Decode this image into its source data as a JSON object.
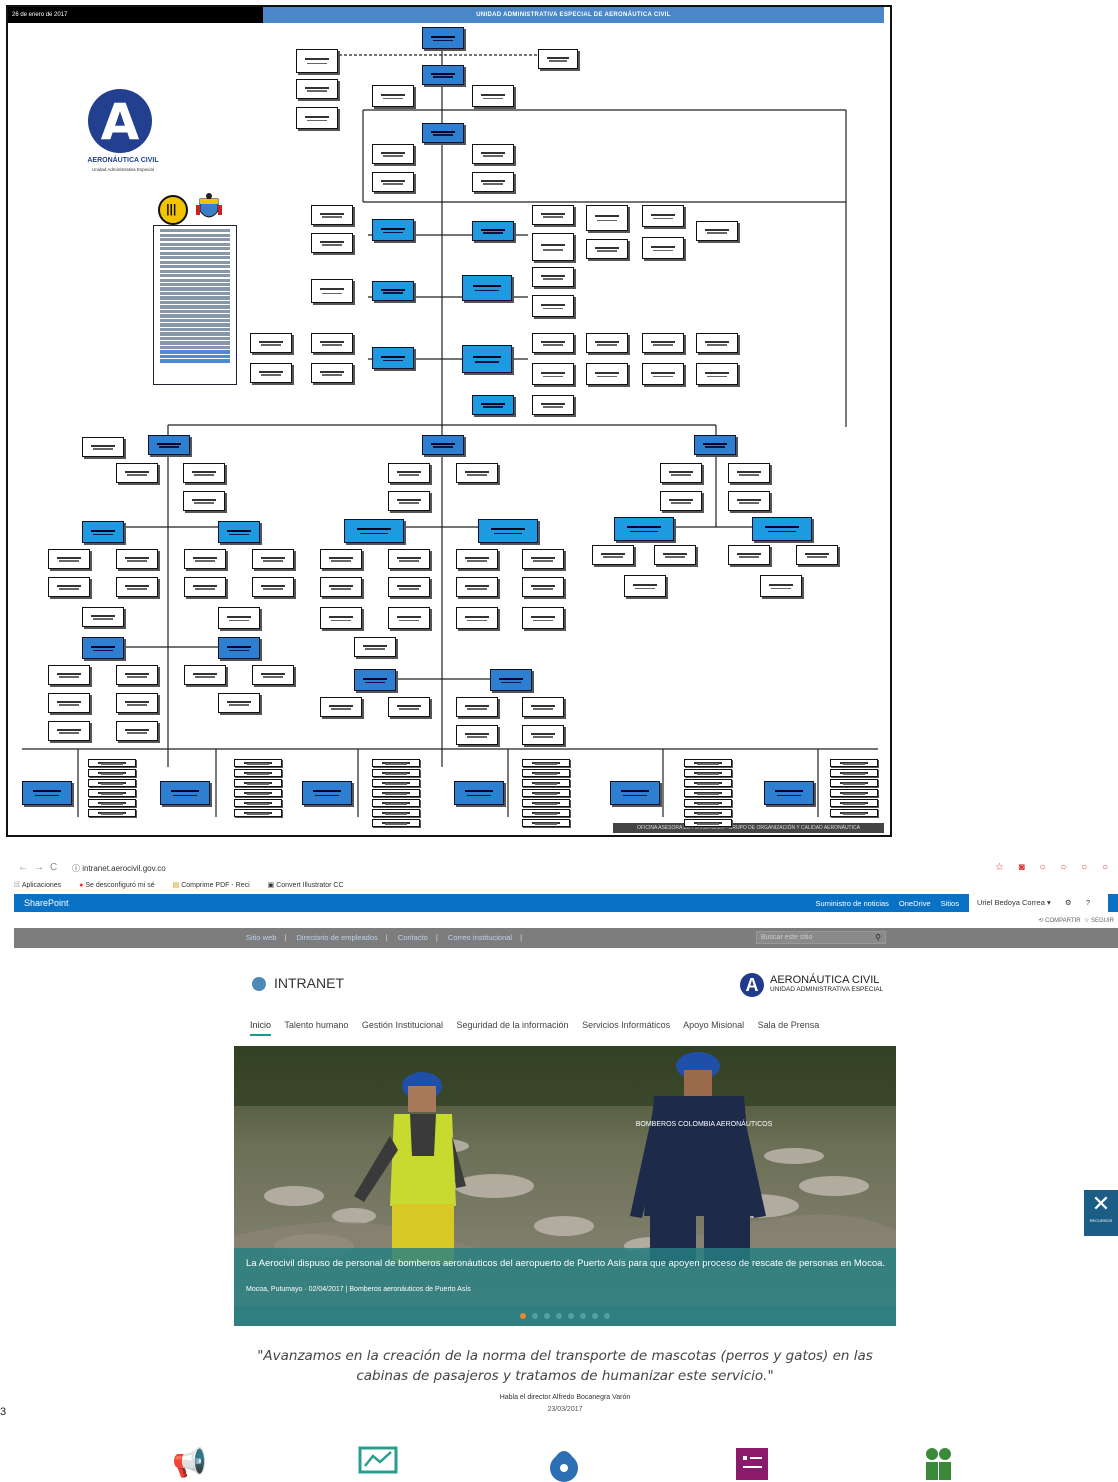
{
  "org_chart": {
    "date": "26 de enero de 2017",
    "title": "UNIDAD ADMINISTRATIVA ESPECIAL DE AERONÁUTICA CIVIL",
    "footer": "OFICINA ASESORA DE PLANEACIÓN - GRUPO DE ORGANIZACIÓN Y CALIDAD AERONÁUTICA",
    "logo_name": "AERONÁUTICA CIVIL",
    "logo_sub": "Unidad Administrativa Especial"
  },
  "page_number": "3",
  "browser": {
    "url": "intranet.aerocivil.gov.co",
    "bookmarks": [
      "Aplicaciones",
      "Se desconfiguró mi sé",
      "Comprime PDF - Reci",
      "Convert Illustrator CC"
    ]
  },
  "sharepoint": {
    "brand": "SharePoint",
    "links": [
      "Suministro de noticias",
      "OneDrive",
      "Sitios"
    ],
    "user": "Uriel Bedoya Correa ▾",
    "share": "COMPARTIR",
    "follow": "SEGUIR"
  },
  "site_nav": {
    "links": [
      "Sitio web",
      "Directorio de empleados",
      "Contacto",
      "Correo institucional"
    ],
    "search_placeholder": "Buscar este sitio"
  },
  "header": {
    "intranet": "INTRANET",
    "logo_title": "AERONÁUTICA CIVIL",
    "logo_sub": "UNIDAD ADMINISTRATIVA ESPECIAL"
  },
  "main_nav": [
    "Inicio",
    "Talento humano",
    "Gestión Institucional",
    "Seguridad de la información",
    "Servicios Informáticos",
    "Apoyo Misional",
    "Sala de Prensa"
  ],
  "hero": {
    "headline": "La Aerocivil dispuso de personal de bomberos aeronáuticos del aeropuerto de Puerto Asís para que apoyen proceso de rescate de personas en Mocoa.",
    "meta": "Mocoa, Putumayo · 02/04/2017 | Bomberos aeronáuticos de Puerto Asís",
    "vest_text": "BOMBEROS COLOMBIA AERONÁUTICOS"
  },
  "quote": {
    "text": "\"Avanzamos en la creación de la norma del transporte de mascotas (perros y gatos) en las cabinas de pasajeros y tratamos de humanizar este servicio.\"",
    "author": "Habla el director Alfredo Bocanegra Varón",
    "date": "23/03/2017"
  },
  "side_tab": {
    "label": "RECURSOS"
  },
  "colors": {
    "sharepoint_blue": "#0a72c4",
    "teal": "#268082",
    "accent_orange": "#e8892c",
    "org_blue": "#2f7fd0"
  }
}
